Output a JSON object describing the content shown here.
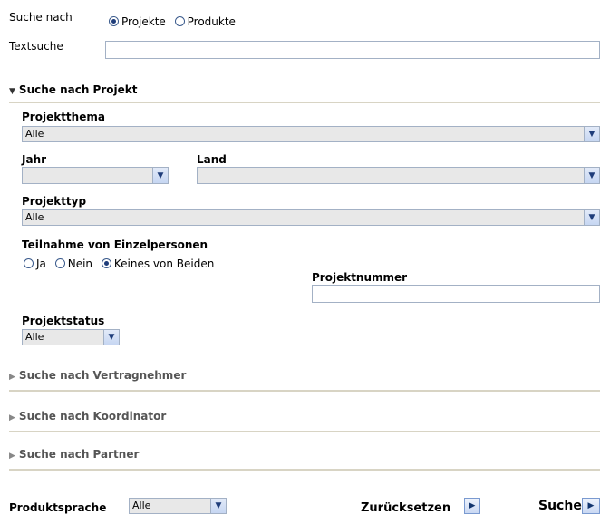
{
  "search_by": {
    "label": "Suche nach",
    "options": [
      {
        "label": "Projekte",
        "selected": true
      },
      {
        "label": "Produkte",
        "selected": false
      }
    ]
  },
  "text_search": {
    "label": "Textsuche",
    "value": ""
  },
  "project_section": {
    "title": "Suche nach Projekt",
    "theme": {
      "label": "Projektthema",
      "value": "Alle"
    },
    "year": {
      "label": "Jahr",
      "value": ""
    },
    "country": {
      "label": "Land",
      "value": ""
    },
    "type": {
      "label": "Projekttyp",
      "value": "Alle"
    },
    "participation": {
      "label": "Teilnahme von Einzelpersonen",
      "options": [
        {
          "label": "Ja",
          "selected": false
        },
        {
          "label": "Nein",
          "selected": false
        },
        {
          "label": "Keines von Beiden",
          "selected": true
        }
      ]
    },
    "number": {
      "label": "Projektnummer",
      "value": ""
    },
    "status": {
      "label": "Projektstatus",
      "value": "Alle"
    }
  },
  "collapsed_sections": [
    {
      "title": "Suche nach Vertragnehmer"
    },
    {
      "title": "Suche nach Koordinator"
    },
    {
      "title": "Suche nach Partner"
    }
  ],
  "footer": {
    "language_label": "Produktsprache",
    "language_value": "Alle",
    "reset_label": "Zurücksetzen",
    "search_label": "Suche"
  },
  "icons": {
    "dropdown": "chevron-down-icon",
    "submit": "play-arrow-icon"
  }
}
